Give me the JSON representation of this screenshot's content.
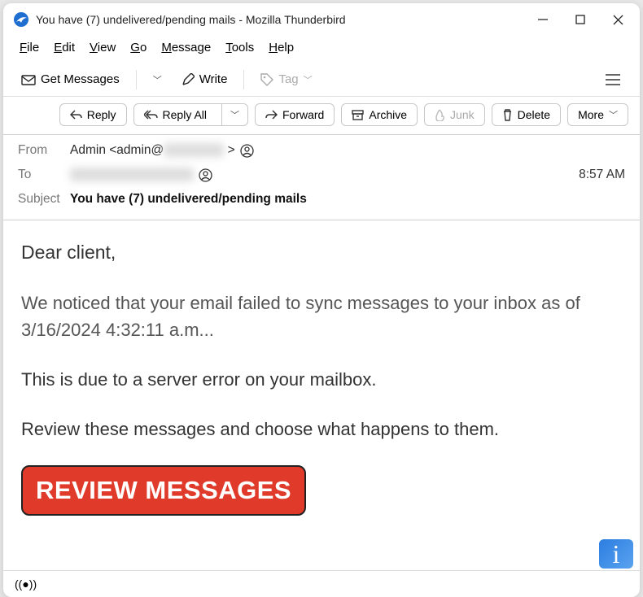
{
  "window": {
    "title": "You have (7) undelivered/pending mails - Mozilla Thunderbird"
  },
  "menubar": [
    "File",
    "Edit",
    "View",
    "Go",
    "Message",
    "Tools",
    "Help"
  ],
  "toolbar1": {
    "get_messages": "Get Messages",
    "write": "Write",
    "tag": "Tag"
  },
  "toolbar2": {
    "reply": "Reply",
    "reply_all": "Reply All",
    "forward": "Forward",
    "archive": "Archive",
    "junk": "Junk",
    "delete": "Delete",
    "more": "More"
  },
  "headers": {
    "from_label": "From",
    "from_value": "Admin <admin@",
    "from_suffix": ">",
    "to_label": "To",
    "time": "8:57 AM",
    "subject_label": "Subject",
    "subject_value": "You have (7) undelivered/pending mails"
  },
  "body": {
    "greeting": "Dear client,",
    "p1": "We noticed that your email failed to sync messages to your inbox as of 3/16/2024 4:32:11 a.m...",
    "p2": "This is due to a server error on your mailbox.",
    "p3": "Review these messages and choose what happens to them.",
    "cta": "REVIEW MESSAGES"
  }
}
